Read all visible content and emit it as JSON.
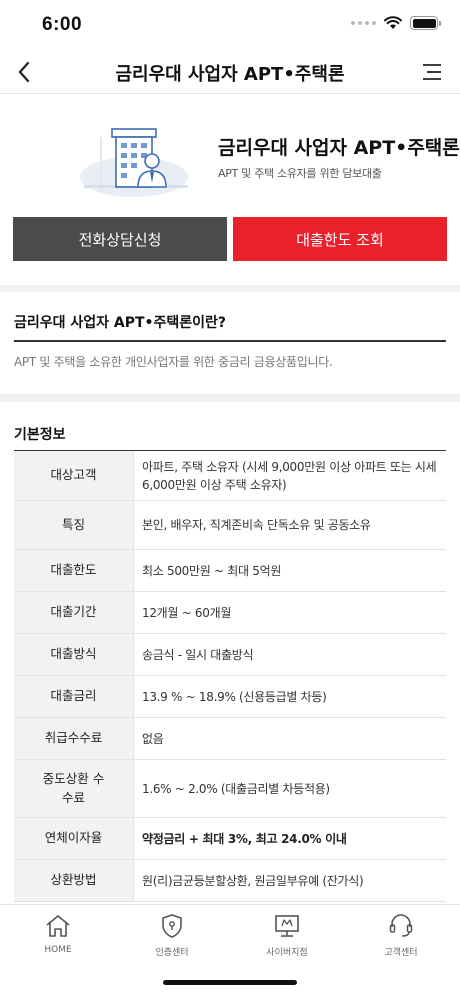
{
  "status": {
    "time": "6:00"
  },
  "header": {
    "title": "금리우대 사업자 APT•주택론"
  },
  "hero": {
    "title": "금리우대 사업자 APT•주택론",
    "subtitle": "APT 및 주택 소유자를 위한 담보대출",
    "call_label": "전화상담신청",
    "limit_label": "대출한도 조회",
    "accent_color": "#e8212b",
    "dark_button_color": "#4b4b4b"
  },
  "about": {
    "title": "금리우대 사업자 APT•주택론이란?",
    "description": "APT 및 주택을 소유한 개인사업자를 위한 중금리 금융상품입니다."
  },
  "info": {
    "title": "기본정보",
    "rows": [
      {
        "label": "대상고객",
        "value": "아파트, 주택 소유자 (시세 9,000만원 이상 아파트 또는 시세 6,000만원 이상 주택 소유자)"
      },
      {
        "label": "특징",
        "value": "본인, 배우자, 직계존비속 단독소유 및 공동소유"
      },
      {
        "label": "대출한도",
        "value": "최소 500만원 ~ 최대 5억원"
      },
      {
        "label": "대출기간",
        "value": "12개월 ~ 60개월"
      },
      {
        "label": "대출방식",
        "value": "송금식 - 일시 대출방식"
      },
      {
        "label": "대출금리",
        "value": "13.9 % ~ 18.9% (신용등급별 차등)"
      },
      {
        "label": "취급수수료",
        "value": "없음"
      },
      {
        "label": "중도상환 수수료",
        "value": "1.6% ~ 2.0% (대출금리별 차등적용)"
      },
      {
        "label": "연체이자율",
        "value": "약정금리 + 최대 3%, 최고 24.0% 이내"
      },
      {
        "label": "상환방법",
        "value": "원(리)금균등분할상환, 원금일부유예 (잔가식)"
      }
    ]
  },
  "tabbar": {
    "items": [
      {
        "label": "HOME",
        "icon": "home-icon"
      },
      {
        "label": "인증센터",
        "icon": "shield-icon"
      },
      {
        "label": "사이버지점",
        "icon": "monitor-icon"
      },
      {
        "label": "고객센터",
        "icon": "headset-icon"
      }
    ]
  }
}
